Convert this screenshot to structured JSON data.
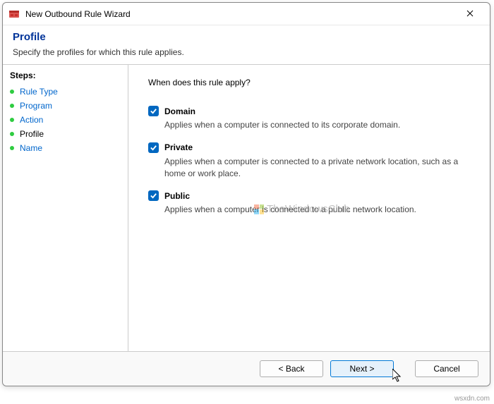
{
  "window": {
    "title": "New Outbound Rule Wizard"
  },
  "header": {
    "title": "Profile",
    "subtitle": "Specify the profiles for which this rule applies."
  },
  "sidebar": {
    "heading": "Steps:",
    "items": [
      {
        "label": "Rule Type",
        "current": false
      },
      {
        "label": "Program",
        "current": false
      },
      {
        "label": "Action",
        "current": false
      },
      {
        "label": "Profile",
        "current": true
      },
      {
        "label": "Name",
        "current": false
      }
    ]
  },
  "content": {
    "question": "When does this rule apply?",
    "options": [
      {
        "title": "Domain",
        "desc": "Applies when a computer is connected to its corporate domain.",
        "checked": true
      },
      {
        "title": "Private",
        "desc": "Applies when a computer is connected to a private network location, such as a home or work place.",
        "checked": true
      },
      {
        "title": "Public",
        "desc": "Applies when a computer is connected to a public network location.",
        "checked": true
      }
    ]
  },
  "footer": {
    "back": "< Back",
    "next": "Next >",
    "cancel": "Cancel"
  },
  "watermark": "TheWindowsClub",
  "attribution": "wsxdn.com"
}
